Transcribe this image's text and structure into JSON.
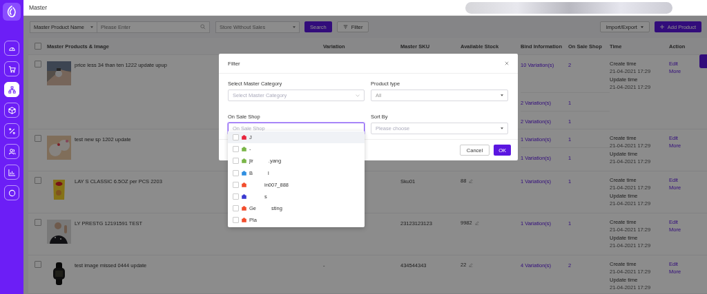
{
  "sidebar": {
    "items": [
      {
        "kind": "gauge",
        "selected": false
      },
      {
        "kind": "cart",
        "selected": false
      },
      {
        "kind": "sitemap",
        "selected": true
      },
      {
        "kind": "box",
        "selected": false
      },
      {
        "kind": "percent",
        "selected": false
      },
      {
        "kind": "users",
        "selected": false
      },
      {
        "kind": "chart",
        "selected": false
      },
      {
        "kind": "chat",
        "selected": false
      }
    ]
  },
  "header": {
    "title": "Master"
  },
  "toolbar": {
    "search_by": "Master Product Name",
    "search": {
      "placeholder": "Please Enter"
    },
    "store_filter": {
      "placeholder": "Store Without Sales"
    },
    "search_button": "Search",
    "filter_button": "Filter",
    "import_export": "Import/Export",
    "add_product": "Add Product"
  },
  "table": {
    "select_all_checked": false,
    "columns": [
      "Master Products & Image",
      "Variation",
      "Master SKU",
      "Available Stock",
      "Bind Information",
      "On Sale Shop",
      "Time",
      "Action"
    ],
    "rows": [
      {
        "checked": false,
        "name": "price less 34 than ten 1222 update upup",
        "bind": [
          {
            "variations": "10 Variation(s)",
            "shops": "2"
          },
          {
            "variations": "2 Variation(s)",
            "shops": "1"
          },
          {
            "variations": "2 Variation(s)",
            "shops": "1"
          }
        ],
        "time": [
          "Create time",
          "21-04-2021 17:29",
          "Update time",
          "21-04-2021 17:29"
        ],
        "actions": [
          "Edit",
          "More"
        ]
      },
      {
        "checked": false,
        "name": "test new sp 1202 update",
        "bind": [
          {
            "variations": "1 Variation(s)",
            "shops": "1"
          },
          {
            "variations": "1 Variation(s)",
            "shops": "1"
          }
        ],
        "time": [
          "Create time",
          "21-04-2021 17:29",
          "Update time",
          "21-04-2021 17:29"
        ],
        "actions": [
          "Edit",
          "More"
        ]
      },
      {
        "checked": false,
        "name": "LAY S CLASSIC 6.5OZ per PCS 2203",
        "sku": "Sku01",
        "stock": "88",
        "bind": [
          {
            "variations": "1 Variation(s)",
            "shops": "1"
          }
        ],
        "time": [
          "Create time",
          "21-04-2021 17:29",
          "Update time",
          "21-04-2021 17:29"
        ],
        "actions": [
          "Edit",
          "More"
        ]
      },
      {
        "checked": false,
        "name": "LY PRESTG 12191591 TEST",
        "sku": "23123123123",
        "stock": "9982",
        "bind": [
          {
            "variations": "1 Variation(s)",
            "shops": "1"
          }
        ],
        "time": [
          "Create time",
          "21-04-2021 17:29",
          "Update time",
          "21-04-2021 17:29"
        ],
        "actions": [
          "Edit",
          "More"
        ]
      },
      {
        "checked": false,
        "name": "test image missed 0444 update",
        "variation": "-",
        "sku": "434544343",
        "stock": "22",
        "bind": [
          {
            "variations": "4 Variation(s)",
            "shops": "2"
          }
        ],
        "time": [
          "Create time",
          "21-04-2021 17:29",
          "Update time",
          "21-04-2021 17:29"
        ],
        "actions": [
          "Edit",
          "More"
        ]
      }
    ]
  },
  "filter_dialog": {
    "title": "Filter",
    "fields": [
      {
        "kind": "cascader",
        "label": "Select Master Category",
        "placeholder": "Select Master Category",
        "focused": false
      },
      {
        "kind": "select",
        "label": "Product type",
        "value": "All",
        "focused": false
      },
      {
        "kind": "input",
        "label": "On Sale Shop",
        "placeholder": "On Sale Shop",
        "focused": true
      },
      {
        "kind": "select",
        "label": "Sort By",
        "placeholder": "Please choose",
        "focused": false
      }
    ],
    "buttons": [
      "Cancel",
      "OK"
    ],
    "shop_options": [
      {
        "label_start": "J",
        "color": "#e8243c",
        "checked": false,
        "hovered": true
      },
      {
        "label_start": "-",
        "color": "#7ab648",
        "checked": false,
        "hovered": false
      },
      {
        "label_start": "jir",
        "label_end": ".yang",
        "color": "#7ab648",
        "checked": false,
        "hovered": false
      },
      {
        "label_start": "B",
        "label_end": "l",
        "color": "#2f8fe0",
        "checked": false,
        "hovered": false
      },
      {
        "label_end": "in007_888",
        "color": "#f24e2e",
        "checked": false,
        "hovered": false
      },
      {
        "label_end": "s",
        "color": "#3a3ad0",
        "checked": false,
        "hovered": false
      },
      {
        "label_start": "Ge",
        "label_end": "sting",
        "color": "#f24e2e",
        "checked": false,
        "hovered": false
      },
      {
        "label_start": "Pla",
        "color": "#f24e2e",
        "checked": false,
        "hovered": false
      }
    ]
  }
}
